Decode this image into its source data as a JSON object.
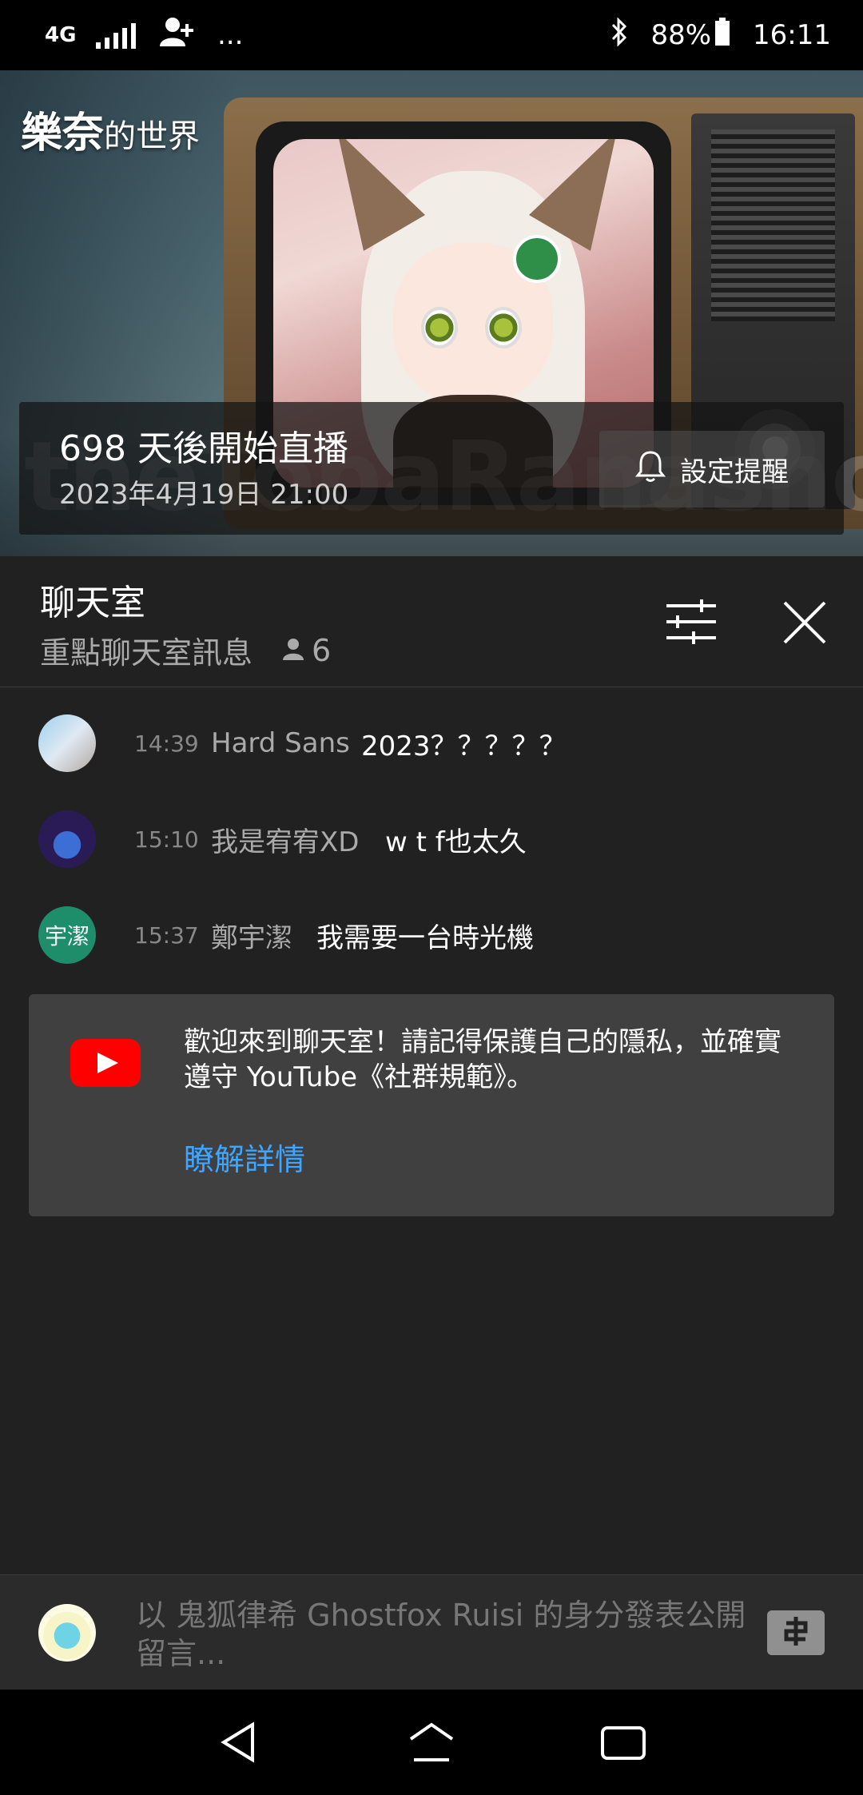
{
  "status_bar": {
    "network": "4G",
    "more": "...",
    "battery": "88%",
    "time": "16:11"
  },
  "video": {
    "channel_name_bold": "樂奈",
    "channel_name_rest": "的世界",
    "show_logo": "theTobaRanashow",
    "live_title": "698 天後開始直播",
    "live_date": "2023年4月19日 21:00",
    "remind_label": "設定提醒"
  },
  "chat": {
    "title": "聊天室",
    "mode": "重點聊天室訊息",
    "viewer_count": "6"
  },
  "messages": [
    {
      "time": "14:39",
      "author": "Hard Sans",
      "text": "2023？？？？？"
    },
    {
      "time": "15:10",
      "author": "我是宥宥XD",
      "text": "w t f也太久"
    },
    {
      "time": "15:37",
      "author": "鄭宇潔",
      "text": "我需要一台時光機",
      "avatar_text": "宇潔"
    }
  ],
  "welcome": {
    "text": "歡迎來到聊天室！請記得保護自己的隱私，並確實遵守 YouTube《社群規範》。",
    "learn_more": "瞭解詳情"
  },
  "input": {
    "placeholder": "以 鬼狐律希 Ghostfox Ruisi 的身分發表公開留言..."
  },
  "colors": {
    "background": "#212121",
    "accent_link": "#3ea6ff",
    "youtube_red": "#ff0000"
  }
}
